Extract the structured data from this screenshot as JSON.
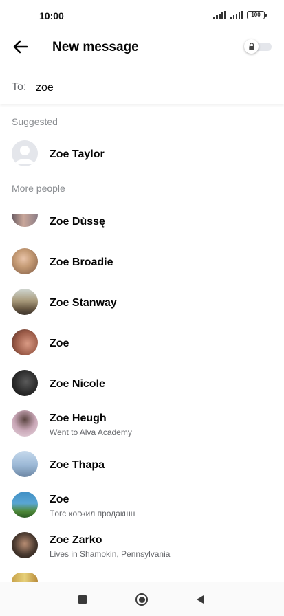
{
  "status_bar": {
    "time": "10:00",
    "battery": "100"
  },
  "header": {
    "title": "New message"
  },
  "to_field": {
    "label": "To:",
    "value": "zoe"
  },
  "sections": {
    "suggested": "Suggested",
    "more_people": "More people"
  },
  "suggested": [
    {
      "name": "Zoe Taylor",
      "avatar": "default-silhouette"
    }
  ],
  "more_people": [
    {
      "name": "Zoe Dùssę",
      "sub": "",
      "avatar_color": "#b58f86"
    },
    {
      "name": "Zoe Broadie",
      "sub": "",
      "avatar_color": "#c49a74"
    },
    {
      "name": "Zoe Stanway",
      "sub": "",
      "avatar_color": "#8a7a5e"
    },
    {
      "name": "Zoe",
      "sub": "",
      "avatar_color": "#9b5b48"
    },
    {
      "name": "Zoe Nicole",
      "sub": "",
      "avatar_color": "#2b2b2b"
    },
    {
      "name": "Zoe Heugh",
      "sub": "Went to Alva Academy",
      "avatar_color": "#c9a7b7"
    },
    {
      "name": "Zoe Thapa",
      "sub": "",
      "avatar_color": "#9bb8d6"
    },
    {
      "name": "Zoe",
      "sub": "Төгс хөгжил продакшн",
      "avatar_color": "#3f8fc4"
    },
    {
      "name": "Zoe Zarko",
      "sub": "Lives in Shamokin, Pennsylvania",
      "avatar_color": "#4a3a30"
    }
  ],
  "colors": {
    "accent": "#0084ff",
    "text_primary": "#050505",
    "text_secondary": "#65676b",
    "section_label": "#8a8d91"
  }
}
